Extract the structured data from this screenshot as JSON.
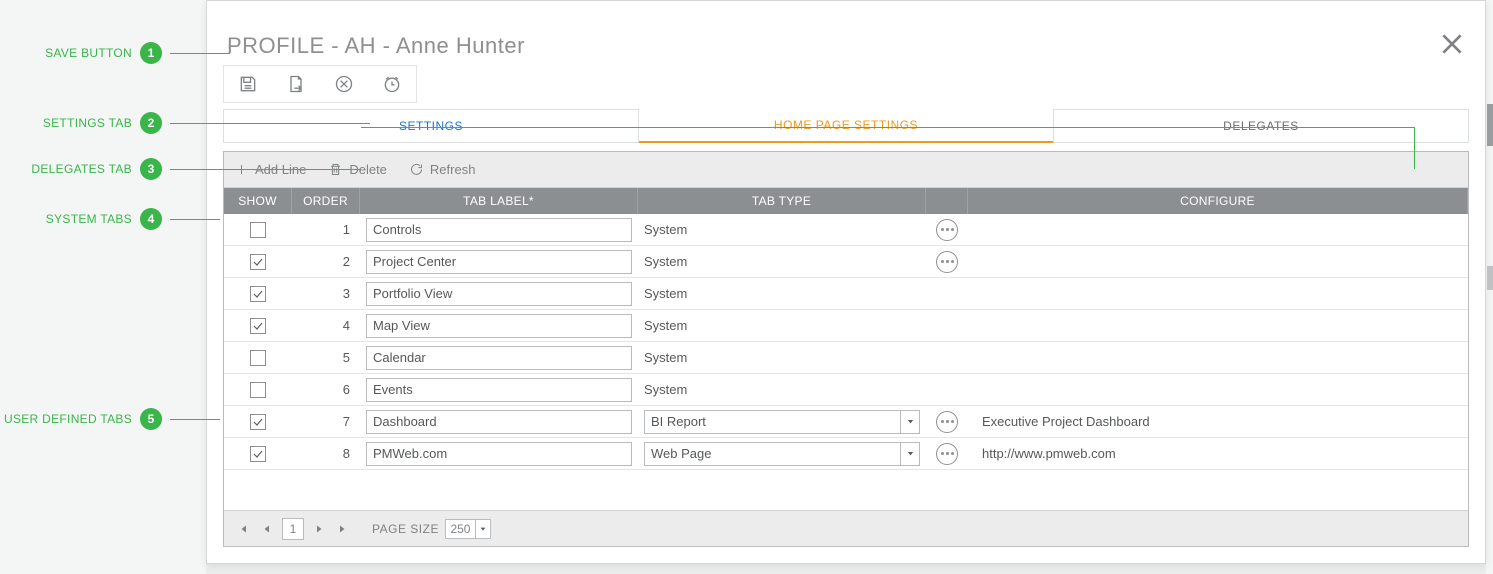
{
  "callouts": [
    {
      "num": "1",
      "label": "SAVE BUTTON"
    },
    {
      "num": "2",
      "label": "SETTINGS TAB"
    },
    {
      "num": "3",
      "label": "DELEGATES TAB"
    },
    {
      "num": "4",
      "label": "SYSTEM TABS"
    },
    {
      "num": "5",
      "label": "USER DEFINED TABS"
    }
  ],
  "modal": {
    "title": "PROFILE - AH - Anne Hunter"
  },
  "tabs": {
    "settings": "SETTINGS",
    "home": "HOME PAGE SETTINGS",
    "delegates": "DELEGATES"
  },
  "gridToolbar": {
    "add": "Add Line",
    "delete": "Delete",
    "refresh": "Refresh"
  },
  "columns": {
    "show": "SHOW",
    "order": "ORDER",
    "label": "TAB LABEL*",
    "type": "TAB TYPE",
    "configure": "CONFIGURE"
  },
  "rows": [
    {
      "show": false,
      "order": "1",
      "label": "Controls",
      "type": "System",
      "typeEditable": false,
      "dots": true,
      "configure": ""
    },
    {
      "show": true,
      "order": "2",
      "label": "Project Center",
      "type": "System",
      "typeEditable": false,
      "dots": true,
      "configure": ""
    },
    {
      "show": true,
      "order": "3",
      "label": "Portfolio View",
      "type": "System",
      "typeEditable": false,
      "dots": false,
      "configure": ""
    },
    {
      "show": true,
      "order": "4",
      "label": "Map View",
      "type": "System",
      "typeEditable": false,
      "dots": false,
      "configure": ""
    },
    {
      "show": false,
      "order": "5",
      "label": "Calendar",
      "type": "System",
      "typeEditable": false,
      "dots": false,
      "configure": ""
    },
    {
      "show": false,
      "order": "6",
      "label": "Events",
      "type": "System",
      "typeEditable": false,
      "dots": false,
      "configure": ""
    },
    {
      "show": true,
      "order": "7",
      "label": "Dashboard",
      "type": "BI Report",
      "typeEditable": true,
      "dots": true,
      "configure": "Executive Project Dashboard"
    },
    {
      "show": true,
      "order": "8",
      "label": "PMWeb.com",
      "type": "Web Page",
      "typeEditable": true,
      "dots": true,
      "configure": "http://www.pmweb.com"
    }
  ],
  "pager": {
    "page": "1",
    "sizeLabel": "PAGE SIZE",
    "size": "250"
  }
}
